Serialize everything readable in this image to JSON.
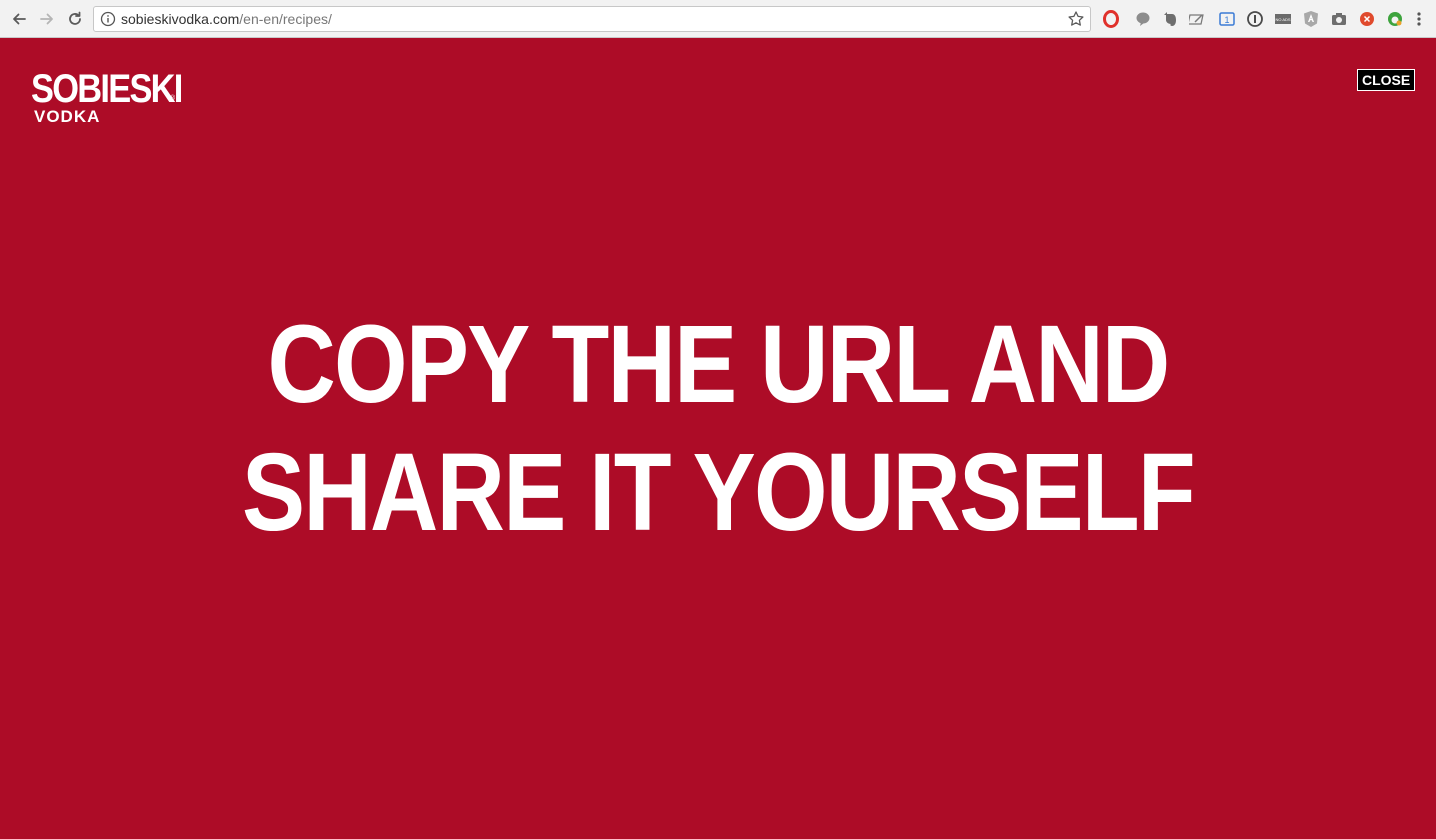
{
  "browser": {
    "url_host": "sobieskivodka.com",
    "url_path": "/en-en/recipes/",
    "extensions": [
      {
        "name": "opera-icon",
        "color": "#e0312b"
      },
      {
        "name": "speech-bubble-icon",
        "color": "#8c8c8c"
      },
      {
        "name": "evernote-icon",
        "color": "#6e6e6e"
      },
      {
        "name": "edit-icon",
        "color": "#7a7a7a"
      },
      {
        "name": "tab-counter-icon",
        "color": "#3a7bd5",
        "badge": "1"
      },
      {
        "name": "one-password-icon",
        "color": "#4a4a4a"
      },
      {
        "name": "no-ads-icon",
        "color": "#6b6b6b",
        "badge": "NO ADS"
      },
      {
        "name": "angular-icon",
        "color": "#a8a8a8"
      },
      {
        "name": "camera-icon",
        "color": "#6e6e6e"
      },
      {
        "name": "close-circle-icon",
        "color": "#e04a2d"
      },
      {
        "name": "frog-icon",
        "color": "#3da33d"
      },
      {
        "name": "menu-dots-icon",
        "color": "#555555"
      }
    ]
  },
  "page": {
    "background_color": "#ad0c27",
    "logo": {
      "top": "SOBIESKI",
      "bottom": "VODKA",
      "registered": "®"
    },
    "close_label": "CLOSE",
    "headline": [
      "COPY THE URL AND",
      "SHARE IT YOURSELF"
    ]
  }
}
